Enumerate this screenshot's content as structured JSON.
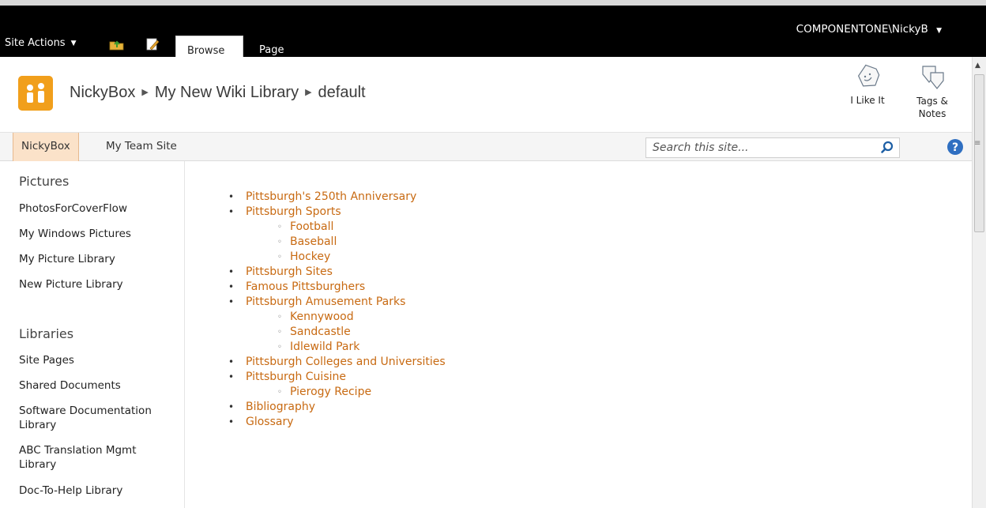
{
  "ribbon": {
    "site_actions": "Site Actions",
    "tabs": [
      {
        "label": "Browse"
      },
      {
        "label": "Page"
      }
    ],
    "user": "COMPONENTONE\\NickyB"
  },
  "title": {
    "breadcrumb": [
      "NickyBox",
      "My New Wiki Library",
      "default"
    ],
    "like_label": "I Like It",
    "tags_label": "Tags &\nNotes"
  },
  "topnav": {
    "items": [
      {
        "label": "NickyBox"
      },
      {
        "label": "My Team Site"
      }
    ],
    "search_placeholder": "Search this site..."
  },
  "quicklaunch": {
    "pictures_heading": "Pictures",
    "pictures": [
      "PhotosForCoverFlow",
      "My Windows Pictures",
      "My Picture Library",
      "New Picture Library"
    ],
    "libraries_heading": "Libraries",
    "libraries": [
      "Site Pages",
      "Shared Documents",
      "Software Documentation Library",
      "ABC Translation Mgmt Library",
      "Doc-To-Help Library"
    ]
  },
  "content": {
    "items": [
      {
        "label": "Pittsburgh's 250th Anniversary",
        "children": []
      },
      {
        "label": "Pittsburgh Sports",
        "children": [
          "Football",
          "Baseball",
          "Hockey"
        ]
      },
      {
        "label": "Pittsburgh Sites",
        "children": []
      },
      {
        "label": "Famous Pittsburghers",
        "children": []
      },
      {
        "label": "Pittsburgh Amusement Parks",
        "children": [
          "Kennywood",
          "Sandcastle",
          "Idlewild Park"
        ]
      },
      {
        "label": "Pittsburgh Colleges and Universities",
        "children": []
      },
      {
        "label": "Pittsburgh Cuisine",
        "children": [
          "Pierogy Recipe"
        ]
      },
      {
        "label": "Bibliography",
        "children": []
      },
      {
        "label": "Glossary",
        "children": []
      }
    ]
  },
  "colors": {
    "accent": "#c86a12",
    "logo": "#f19f1b",
    "ribbon": "#000000",
    "selected_nav": "#fbe2c9"
  },
  "icons": [
    "navigate-up-icon",
    "edit-page-icon",
    "i-like-it-icon",
    "tags-notes-icon",
    "search-icon",
    "help-icon",
    "site-logo-icon"
  ]
}
